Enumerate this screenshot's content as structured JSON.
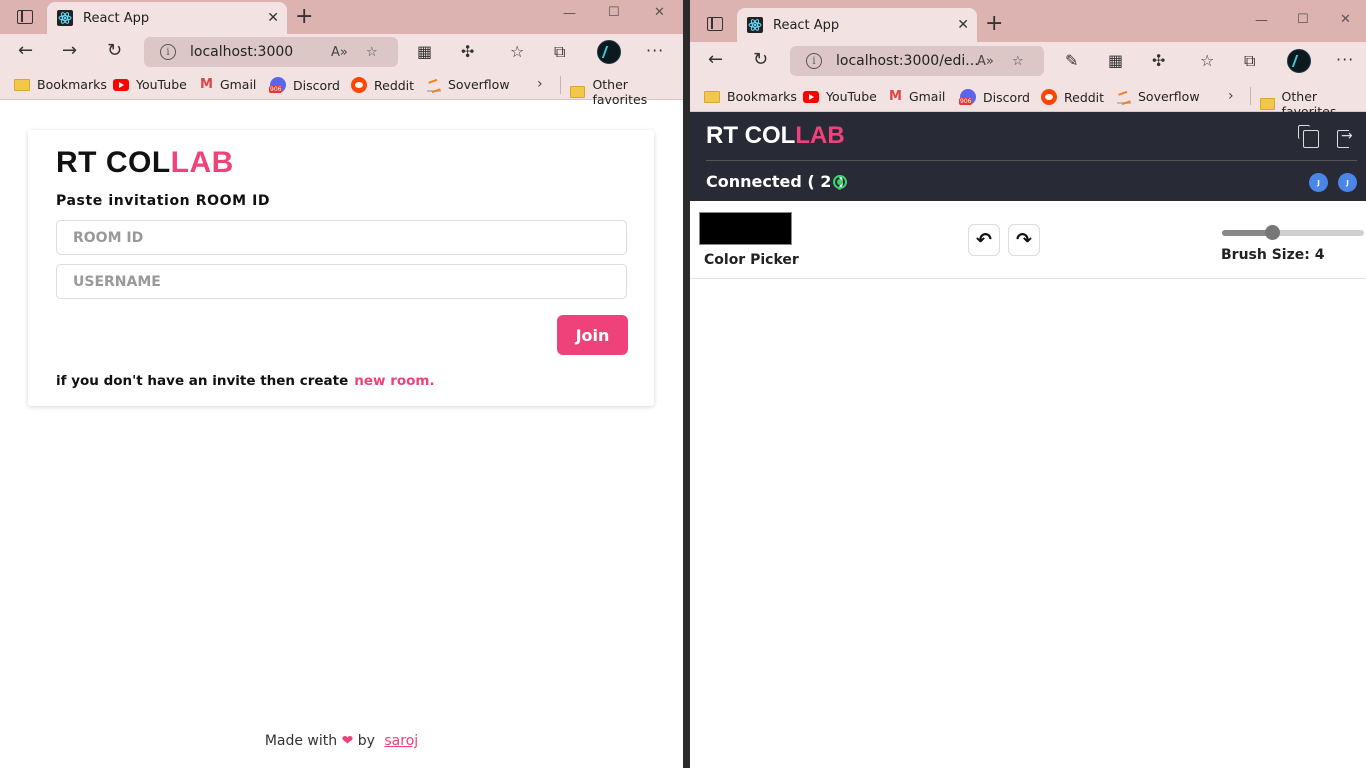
{
  "left_window": {
    "tab_title": "React App",
    "url": "localhost:3000",
    "bookmarks": [
      "Bookmarks",
      "YouTube",
      "Gmail",
      "Discord",
      "Reddit",
      "Soverflow"
    ],
    "other_favorites": "Other favorites",
    "app": {
      "logo_main": "RT COL",
      "logo_accent": "LAB",
      "paste_label": "Paste invitation ROOM ID",
      "room_placeholder": "ROOM ID",
      "username_placeholder": "USERNAME",
      "join_label": "Join",
      "invite_text": "if you don't have an invite then create",
      "new_room_link": "new room.",
      "footer_made": "Made with",
      "footer_heart": "❤",
      "footer_by": "by",
      "footer_author": "saroj"
    }
  },
  "right_window": {
    "tab_title": "React App",
    "url": "localhost:3000/edi...",
    "bookmarks": [
      "Bookmarks",
      "YouTube",
      "Gmail",
      "Discord",
      "Reddit",
      "Soverflow"
    ],
    "other_favorites": "Other favorites",
    "app": {
      "logo_main": "RT COL",
      "logo_accent": "LAB",
      "connected_label": "Connected ( 2 )",
      "avatars": [
        "J",
        "J"
      ],
      "color_picker_label": "Color Picker",
      "selected_color": "#000000",
      "undo_icon": "↶",
      "redo_icon": "↷",
      "brush_size_label": "Brush Size: 4",
      "brush_size": 4
    }
  },
  "colors": {
    "accent": "#f0427a",
    "header_bg": "#282a36",
    "browser_frame": "#dcb3b1",
    "online": "#3ad36b"
  }
}
